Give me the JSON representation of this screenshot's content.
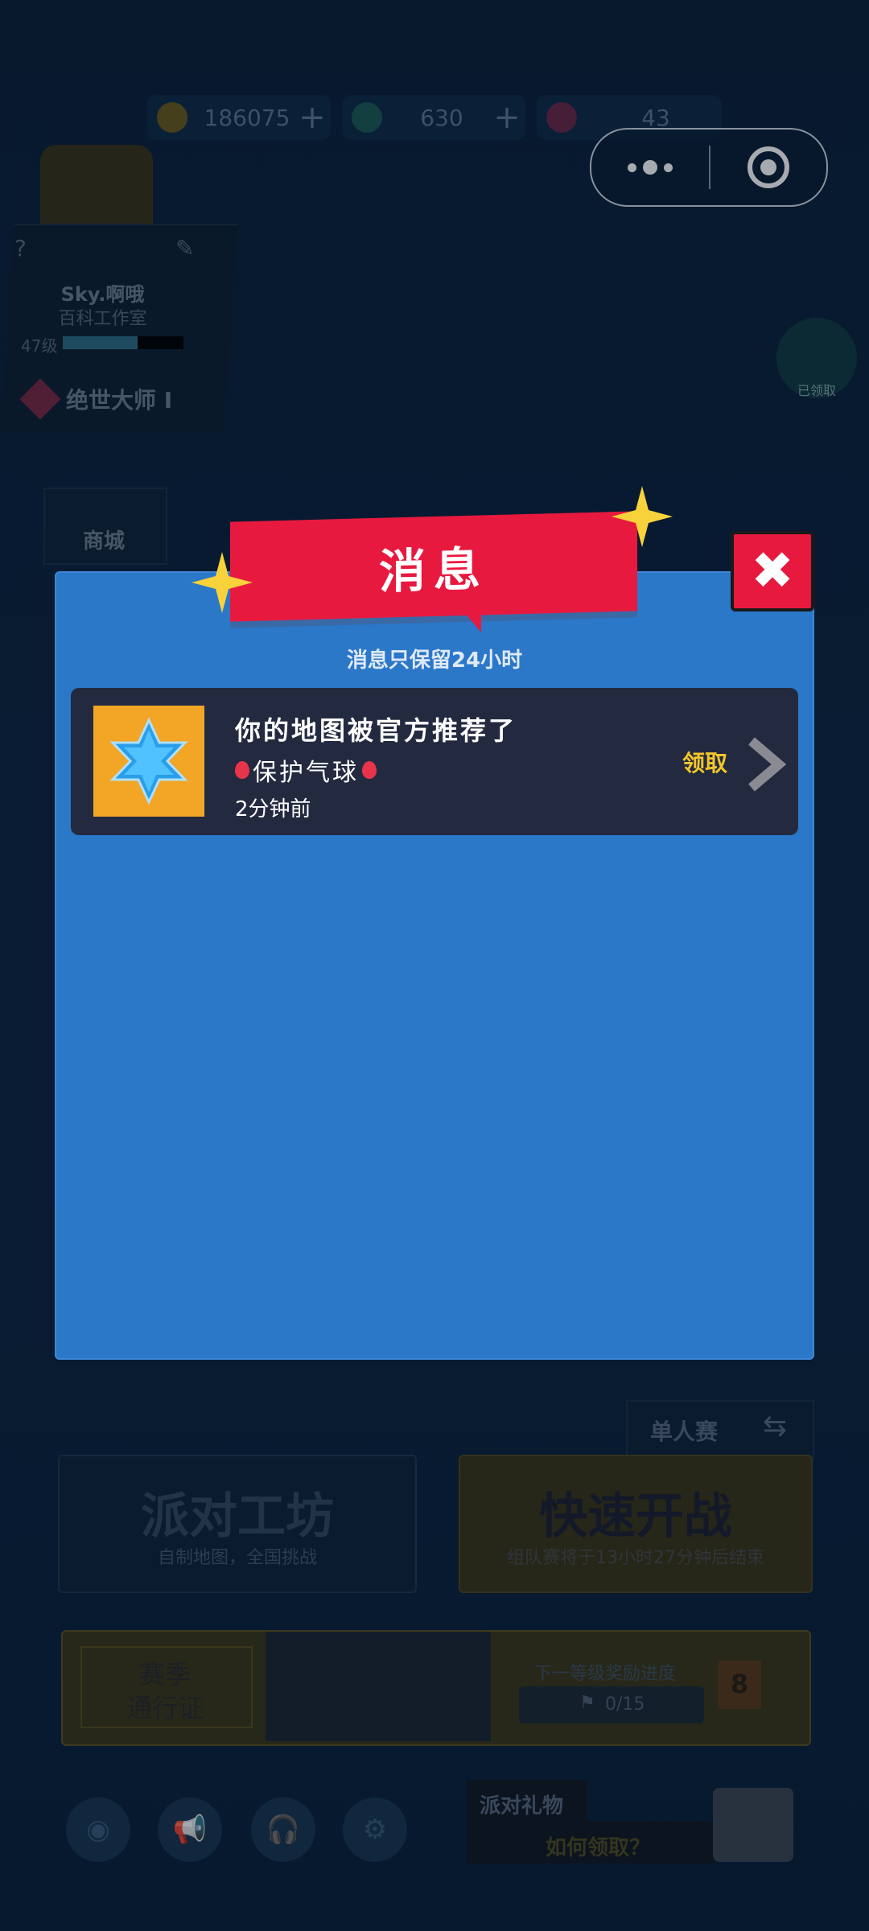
{
  "resources": {
    "coins": "186075",
    "gems": "630",
    "tickets": "43"
  },
  "profile": {
    "name": "Sky.啊哦",
    "studio": "百科工作室",
    "level": "47级",
    "level_progress": 0.62,
    "rank": "绝世大师 I"
  },
  "side": {
    "shop": "商城",
    "claimed": "已领取"
  },
  "modal": {
    "title": "消息",
    "subtitle": "消息只保留24小时",
    "messages": [
      {
        "title": "你的地图被官方推荐了",
        "subtitle": "保护气球",
        "time": "2分钟前",
        "action": "领取"
      }
    ]
  },
  "bottom": {
    "single_mode": "单人赛",
    "party_workshop": "派对工坊",
    "party_workshop_sub": "自制地图，全国挑战",
    "quick_battle": "快速开战",
    "quick_battle_sub": "组队赛将于13小时27分钟后结束",
    "season_pass_line1": "赛季",
    "season_pass_line2": "通行证",
    "next_reward": "下一等级奖励进度",
    "progress": "0/15",
    "reward_level": "8",
    "party_gift": "派对礼物",
    "how_to_claim": "如何领取？"
  },
  "colors": {
    "modal_bg": "#2b77c8",
    "banner": "#e8193f",
    "claim": "#f3c62a",
    "thumb": "#f3a626"
  }
}
